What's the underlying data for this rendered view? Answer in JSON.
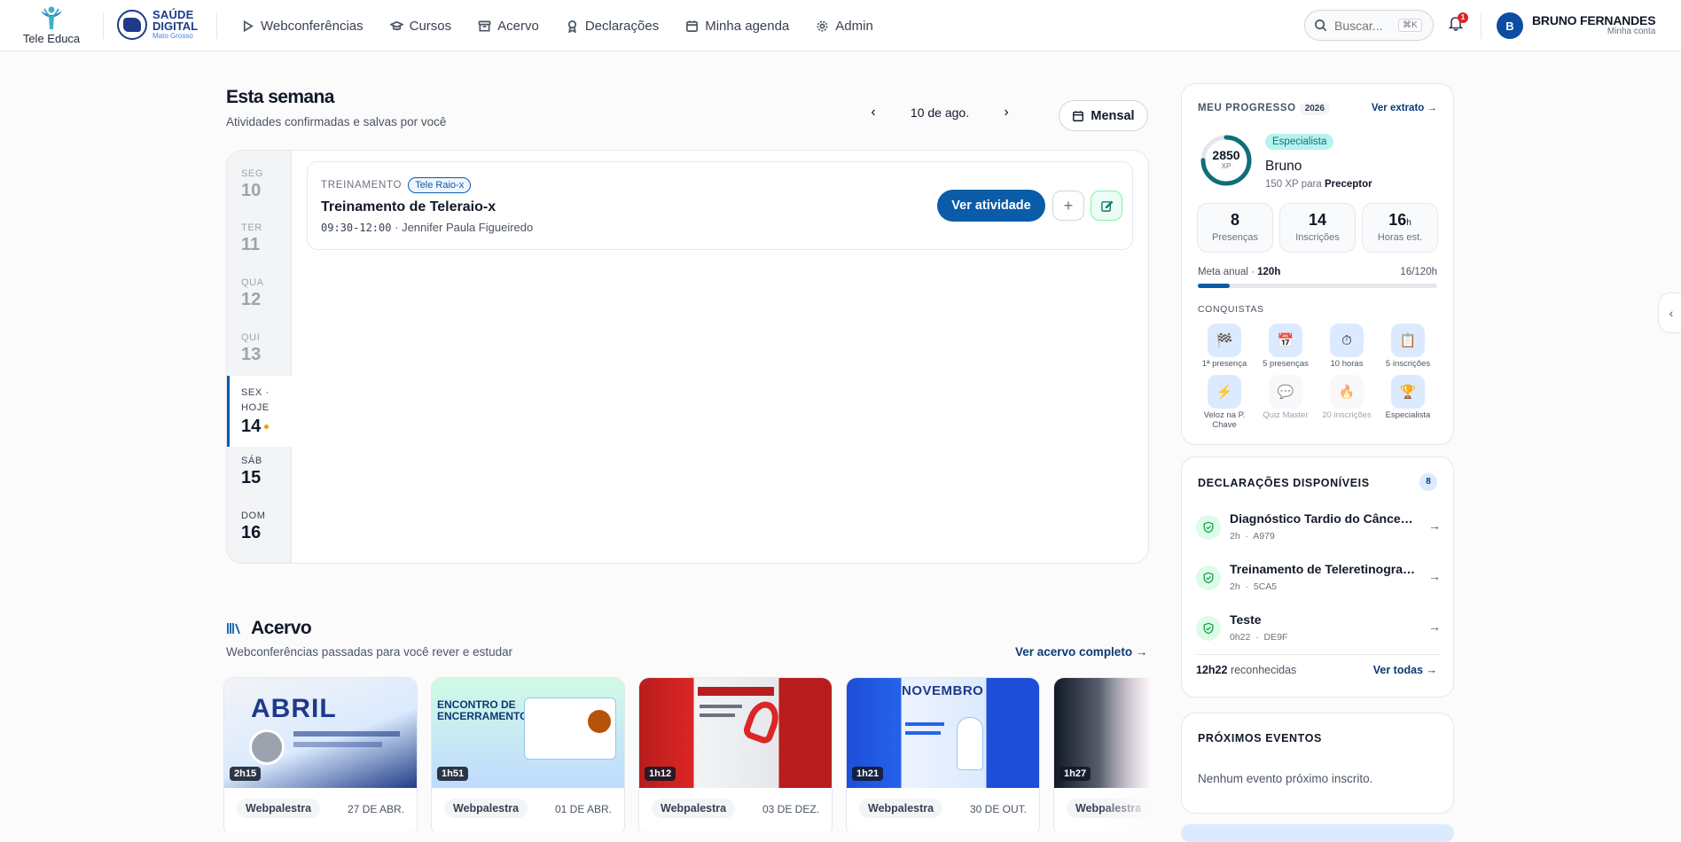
{
  "brand": {
    "tele_educa": "Tele Educa",
    "saude_line1": "SAÚDE",
    "saude_line2": "DIGITAL",
    "saude_line3": "Mato Grosso"
  },
  "nav": {
    "items": [
      {
        "label": "Webconferências",
        "icon": "play-icon"
      },
      {
        "label": "Cursos",
        "icon": "graduation-cap-icon"
      },
      {
        "label": "Acervo",
        "icon": "archive-icon"
      },
      {
        "label": "Declarações",
        "icon": "award-icon"
      },
      {
        "label": "Minha agenda",
        "icon": "calendar-icon"
      },
      {
        "label": "Admin",
        "icon": "gear-icon"
      }
    ]
  },
  "search": {
    "placeholder": "Buscar...",
    "shortcut": "⌘K"
  },
  "notifications": {
    "count": "1"
  },
  "user": {
    "initial": "B",
    "name": "BRUNO FERNANDES",
    "subtitle": "Minha conta"
  },
  "week": {
    "title": "Esta semana",
    "subtitle": "Atividades confirmadas e salvas por você",
    "date_label": "10 de ago.",
    "view_button": "Mensal",
    "days": [
      {
        "name": "SEG",
        "date": "10",
        "state": "past"
      },
      {
        "name": "TER",
        "date": "11",
        "state": "past"
      },
      {
        "name": "QUA",
        "date": "12",
        "state": "past"
      },
      {
        "name": "QUI",
        "date": "13",
        "state": "past"
      },
      {
        "name": "SEX ·",
        "name2": "HOJE",
        "date": "14",
        "state": "today"
      },
      {
        "name": "SÁB",
        "date": "15",
        "state": "future"
      },
      {
        "name": "DOM",
        "date": "16",
        "state": "future"
      }
    ],
    "event": {
      "type": "TREINAMENTO",
      "tag": "Tele Raio-x",
      "title": "Treinamento de Teleraio-x",
      "time": "09:30-12:00",
      "separator": "·",
      "presenter": "Jennifer Paula Figueiredo",
      "cta": "Ver atividade",
      "add": "+"
    }
  },
  "acervo": {
    "title": "Acervo",
    "subtitle": "Webconferências passadas para você rever e estudar",
    "link": "Ver acervo completo →",
    "cards": [
      {
        "duration": "2h15",
        "tag": "Webpalestra",
        "date": "27 DE ABR.",
        "thumb_title": "ABRIL"
      },
      {
        "duration": "1h51",
        "tag": "Webpalestra",
        "date": "01 DE ABR.",
        "thumb_title": "ENCONTRO DE ENCERRAMENTO"
      },
      {
        "duration": "1h12",
        "tag": "Webpalestra",
        "date": "03 DE DEZ.",
        "thumb_title": ""
      },
      {
        "duration": "1h21",
        "tag": "Webpalestra",
        "date": "30 DE OUT.",
        "thumb_title": "NOVEMBRO"
      },
      {
        "duration": "1h27",
        "tag": "Webpalestra",
        "date": "",
        "thumb_title": ""
      }
    ]
  },
  "progress": {
    "heading": "MEU PROGRESSO",
    "year": "2026",
    "link": "Ver extrato →",
    "xp": "2850",
    "xp_label": "XP",
    "xp_ring_fraction": 0.75,
    "level": "Especialista",
    "name": "Bruno",
    "next_text": "150 XP para",
    "next_level": "Preceptor",
    "stats": [
      {
        "value": "8",
        "unit": "",
        "label": "Presenças"
      },
      {
        "value": "14",
        "unit": "",
        "label": "Inscrições"
      },
      {
        "value": "16",
        "unit": "h",
        "label": "Horas est."
      }
    ],
    "goal_label": "Meta anual ·",
    "goal_value": "120h",
    "goal_progress": "16/120h",
    "goal_fraction": 0.133,
    "achievements_heading": "CONQUISTAS",
    "achievements": [
      {
        "label": "1ª presença",
        "icon": "checkered-flag-icon",
        "glyph": "🏁",
        "locked": false
      },
      {
        "label": "5 presenças",
        "icon": "calendar-icon",
        "glyph": "📅",
        "locked": false
      },
      {
        "label": "10 horas",
        "icon": "stopwatch-icon",
        "glyph": "⏱",
        "locked": false
      },
      {
        "label": "5 inscrições",
        "icon": "clipboard-icon",
        "glyph": "📋",
        "locked": false
      },
      {
        "label": "Veloz na P. Chave",
        "icon": "lightning-icon",
        "glyph": "⚡",
        "locked": false
      },
      {
        "label": "Quiz Master",
        "icon": "speech-bubble-icon",
        "glyph": "💬",
        "locked": true
      },
      {
        "label": "20 inscrições",
        "icon": "flame-icon",
        "glyph": "🔥",
        "locked": true
      },
      {
        "label": "Especialista",
        "icon": "trophy-icon",
        "glyph": "🏆",
        "locked": false
      }
    ]
  },
  "declarations": {
    "heading": "DECLARAÇÕES DISPONÍVEIS",
    "count": "8",
    "items": [
      {
        "title": "Diagnóstico Tardio do Câncer de Mama",
        "hours": "2h",
        "dot": "·",
        "code": "A979"
      },
      {
        "title": "Treinamento de Teleretinografia",
        "hours": "2h",
        "dot": "·",
        "code": "5CA5"
      },
      {
        "title": "Teste",
        "hours": "0h22",
        "dot": "·",
        "code": "DE9F"
      }
    ],
    "total": "12h22",
    "total_label": "reconhecidas",
    "link": "Ver todas →"
  },
  "events": {
    "heading": "PRÓXIMOS EVENTOS",
    "empty": "Nenhum evento próximo inscrito."
  },
  "colors": {
    "primary": "#0b5ca8",
    "navy": "#0b3a73",
    "teal": "#0f766e"
  }
}
